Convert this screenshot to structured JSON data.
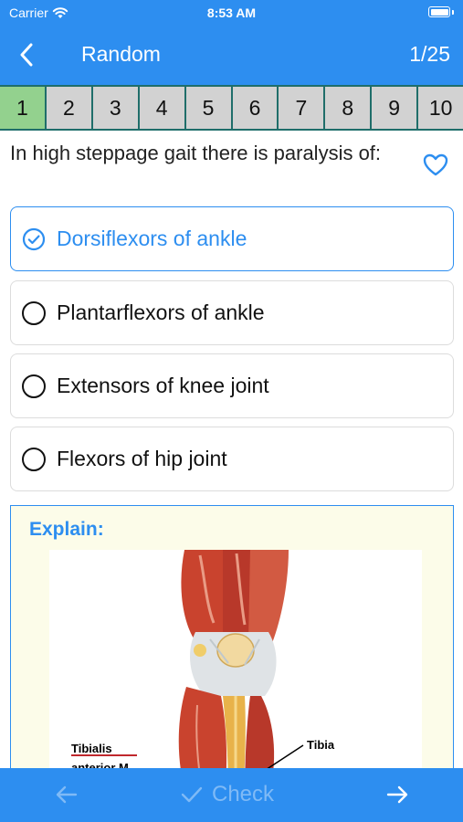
{
  "status": {
    "carrier": "Carrier",
    "time": "8:53 AM"
  },
  "nav": {
    "title": "Random",
    "counter": "1/25"
  },
  "numbers": [
    "1",
    "2",
    "3",
    "4",
    "5",
    "6",
    "7",
    "8",
    "9",
    "10"
  ],
  "question": {
    "text": "In high steppage gait there is paralysis of:"
  },
  "options": [
    {
      "label": "Dorsiflexors of ankle",
      "selected": true
    },
    {
      "label": "Plantarflexors of ankle",
      "selected": false
    },
    {
      "label": "Extensors of knee joint",
      "selected": false
    },
    {
      "label": "Flexors of hip joint",
      "selected": false
    }
  ],
  "explain": {
    "title": "Explain:",
    "figure_labels": {
      "muscle_line1": "Tibialis",
      "muscle_line2": "anterior M.",
      "bone": "Tibia"
    }
  },
  "bottom": {
    "check_label": "Check"
  },
  "colors": {
    "accent": "#2d8ef0",
    "active_number": "#93d18e"
  }
}
